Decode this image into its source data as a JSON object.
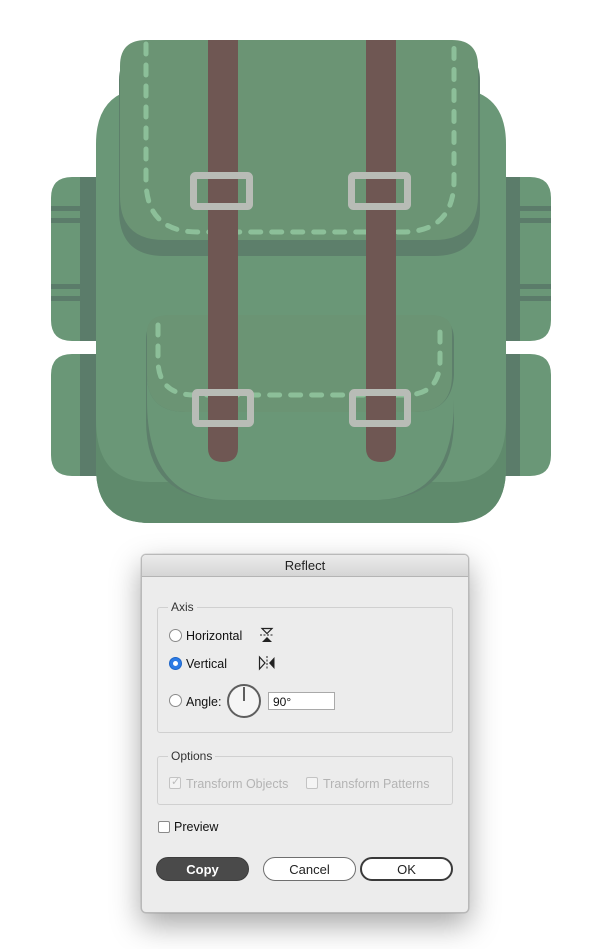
{
  "colors": {
    "bag_main": "#6a9777",
    "bag_shadow": "#5b7c6a",
    "flap": "#6b9474",
    "strap": "#6f5753",
    "buckle": "#b8bcb6",
    "stitch": "#8cbf99",
    "accent_blue": "#2c7be5"
  },
  "dialog": {
    "title": "Reflect",
    "axis_group": {
      "label": "Axis",
      "horizontal_label": "Horizontal",
      "vertical_label": "Vertical",
      "angle_label": "Angle:",
      "angle_value": "90°",
      "selected": "Vertical"
    },
    "options_group": {
      "label": "Options",
      "transform_objects_label": "Transform Objects",
      "transform_objects_checked": true,
      "transform_patterns_label": "Transform Patterns",
      "transform_patterns_checked": false
    },
    "preview_label": "Preview",
    "preview_checked": false,
    "buttons": {
      "copy": "Copy",
      "cancel": "Cancel",
      "ok": "OK"
    }
  },
  "icons": {
    "horizontal_axis": "reflect-horizontal-icon",
    "vertical_axis": "reflect-vertical-icon",
    "angle_dial": "angle-dial-icon"
  }
}
